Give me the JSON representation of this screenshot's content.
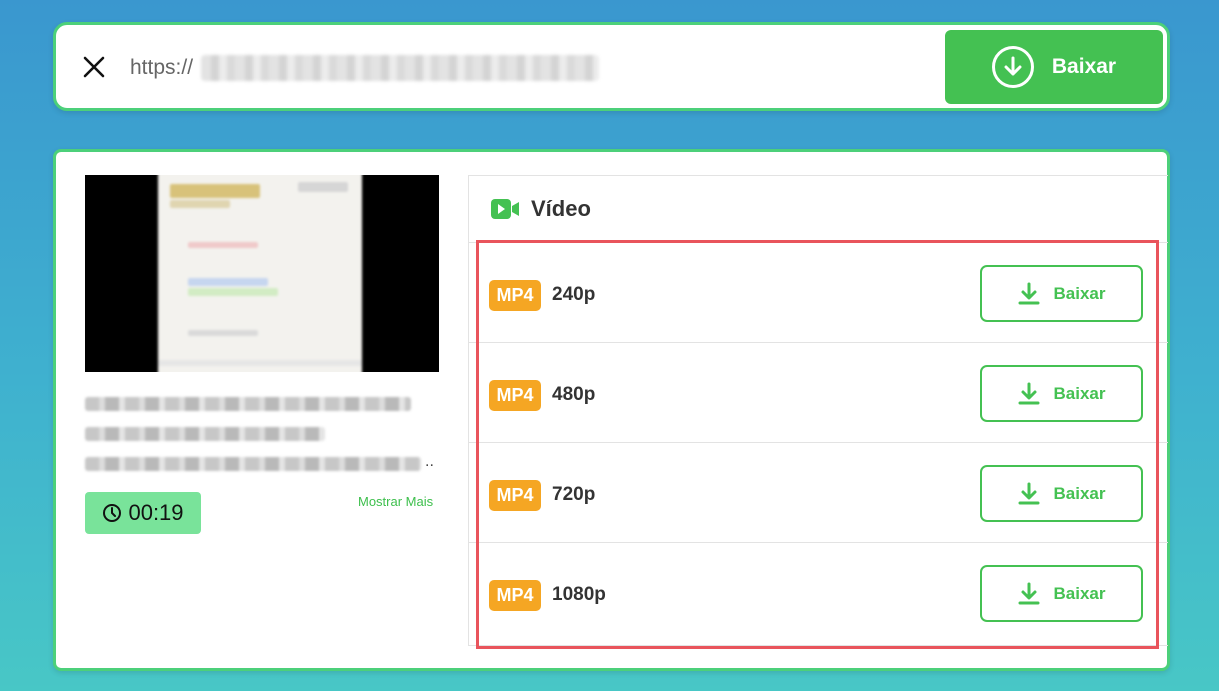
{
  "url_bar": {
    "close_icon": "close-icon",
    "url_prefix": "https://",
    "download_label": "Baixar",
    "download_icon": "download-circle-icon"
  },
  "media": {
    "ellipsis": "..",
    "duration": "00:19",
    "duration_icon": "clock-icon",
    "show_more": "Mostrar Mais"
  },
  "video": {
    "header_icon": "video-camera-icon",
    "header": "Vídeo",
    "rows": [
      {
        "format": "MP4",
        "quality": "240p",
        "button": "Baixar"
      },
      {
        "format": "MP4",
        "quality": "480p",
        "button": "Baixar"
      },
      {
        "format": "MP4",
        "quality": "720p",
        "button": "Baixar"
      },
      {
        "format": "MP4",
        "quality": "1080p",
        "button": "Baixar"
      }
    ]
  },
  "colors": {
    "primary_green": "#44c152",
    "border_green": "#4cd07a",
    "badge_orange": "#f5a623",
    "duration_bg": "#79e39a",
    "highlight_red": "#e9545c"
  }
}
